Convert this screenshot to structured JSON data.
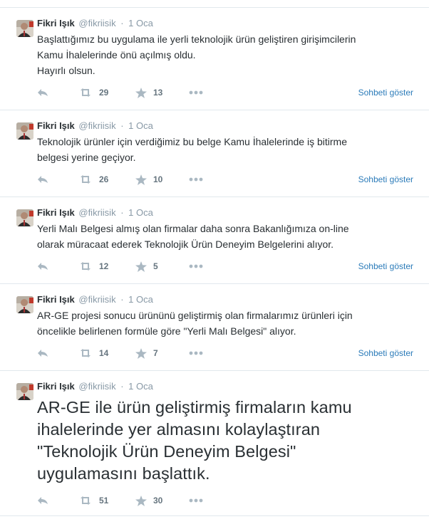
{
  "tweets": [
    {
      "fullname": "Fikri Işık",
      "username": "@fikriisik",
      "separator": "·",
      "time": "1 Oca",
      "text": "Başlattığımız bu uygulama ile yerli teknolojik ürün geliştiren girişimcilerin\nKamu İhalelerinde önü açılmış oldu.\nHayırlı olsun.",
      "retweets": "29",
      "favorites": "13",
      "conversation_link": "Sohbeti göster"
    },
    {
      "fullname": "Fikri Işık",
      "username": "@fikriisik",
      "separator": "·",
      "time": "1 Oca",
      "text": "Teknolojik ürünler için verdiğimiz bu belge Kamu İhalelerinde iş bitirme\nbelgesi yerine geçiyor.",
      "retweets": "26",
      "favorites": "10",
      "conversation_link": "Sohbeti göster"
    },
    {
      "fullname": "Fikri Işık",
      "username": "@fikriisik",
      "separator": "·",
      "time": "1 Oca",
      "text": "Yerli Malı Belgesi almış olan firmalar daha sonra Bakanlığımıza on-line\nolarak müracaat ederek Teknolojik Ürün Deneyim Belgelerini alıyor.",
      "retweets": "12",
      "favorites": "5",
      "conversation_link": "Sohbeti göster"
    },
    {
      "fullname": "Fikri Işık",
      "username": "@fikriisik",
      "separator": "·",
      "time": "1 Oca",
      "text": "AR-GE projesi sonucu ürününü geliştirmiş olan firmalarımız ürünleri için\nöncelikle belirlenen formüle göre \"Yerli Malı Belgesi\" alıyor.",
      "retweets": "14",
      "favorites": "7",
      "conversation_link": "Sohbeti göster"
    },
    {
      "fullname": "Fikri Işık",
      "username": "@fikriisik",
      "separator": "·",
      "time": "1 Oca",
      "text": "AR-GE ile ürün geliştirmiş firmaların kamu\nihalelerinde yer almasını kolaylaştıran\n\"Teknolojik Ürün Deneyim Belgesi\"\nuygulamasını başlattık.",
      "retweets": "51",
      "favorites": "30",
      "conversation_link": ""
    }
  ],
  "icons": {
    "reply": "reply-icon",
    "retweet": "retweet-icon",
    "favorite": "star-icon",
    "more": "more-dots-icon"
  },
  "colors": {
    "text": "#292f33",
    "muted": "#8899a6",
    "icon": "#aab8c2",
    "link": "#2b7bb9",
    "border": "#e1e8ed"
  }
}
